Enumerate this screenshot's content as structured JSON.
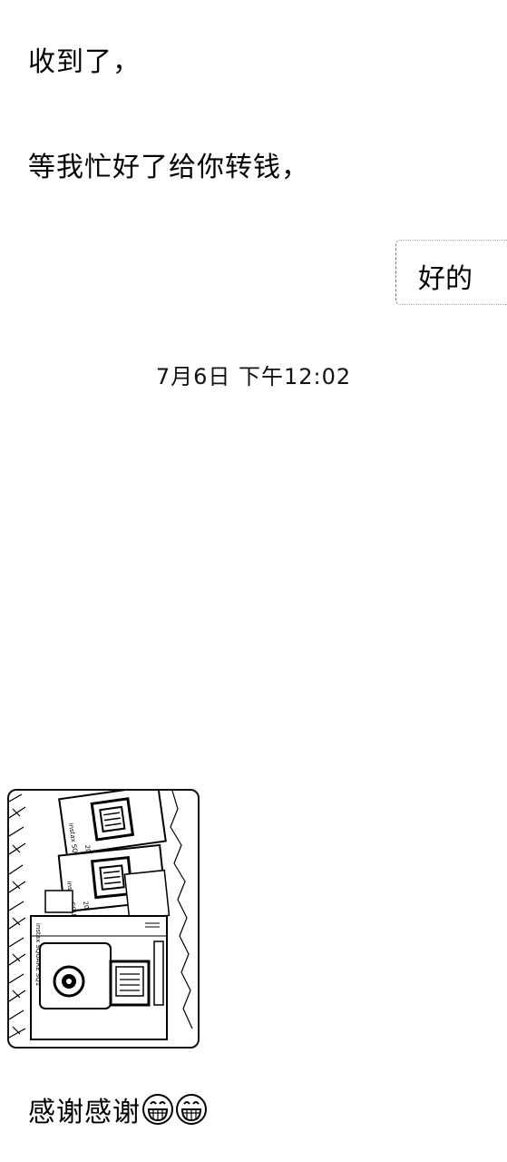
{
  "chat": {
    "messages": [
      {
        "side": "left",
        "text": "收到了，"
      },
      {
        "side": "left",
        "text": "等我忙好了给你转钱，"
      },
      {
        "side": "right",
        "text": "好的"
      },
      {
        "side": "left",
        "text": "感谢感谢"
      }
    ],
    "timestamp": "7月6日 下午12:02",
    "photo": {
      "box_labels": [
        "instax SQUARE",
        "instax SQUARE",
        "instax SQUARE SQ1"
      ],
      "count_marks": [
        "20",
        "20"
      ],
      "description_icon": "camera-box-photo"
    },
    "emoji": [
      "grinning-face-icon",
      "grinning-face-icon"
    ]
  },
  "colors": {
    "background": "#ffffff",
    "text": "#000000"
  }
}
